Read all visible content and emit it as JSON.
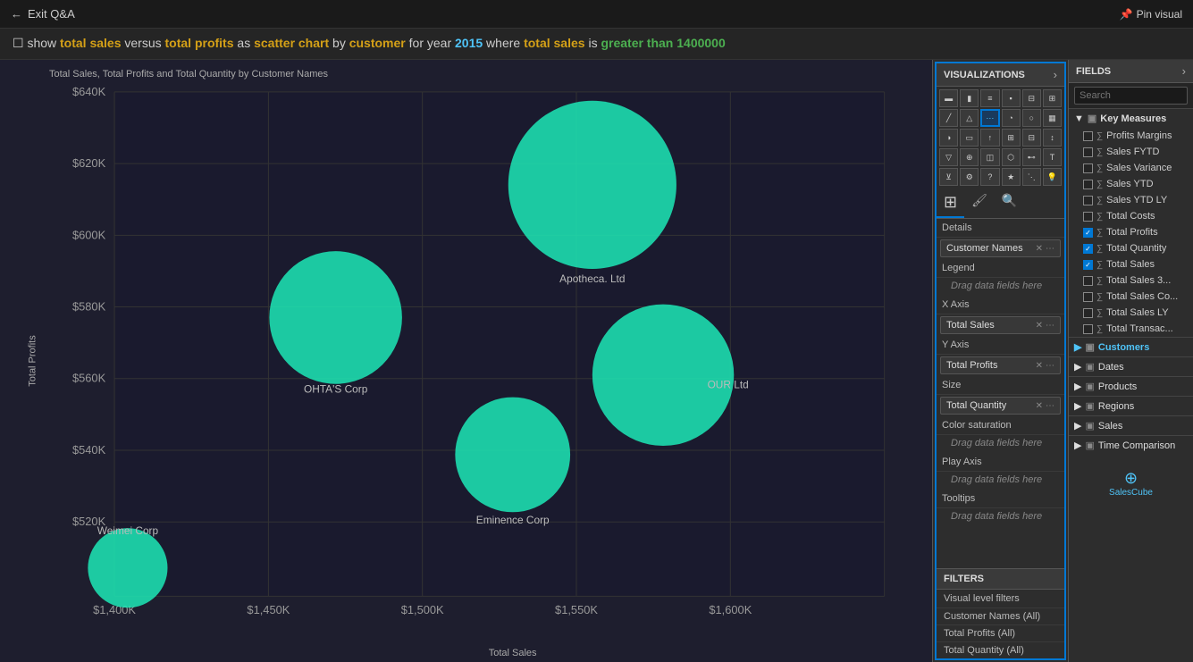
{
  "topbar": {
    "back_label": "Exit Q&A",
    "pin_label": "Pin visual"
  },
  "querybar": {
    "prefix": "show ",
    "total_sales": "total sales",
    "vs": " versus ",
    "total_profits": "total profits",
    "as": " as ",
    "scatter_chart": "scatter chart",
    "by": " by ",
    "customer": "customer",
    "for_year": " for year ",
    "year": "2015",
    "where": " where ",
    "total_sales2": "total sales",
    "is": " is ",
    "condition": "greater than 1400000"
  },
  "chart": {
    "title": "Total Sales, Total Profits and Total Quantity by Customer Names",
    "y_axis_label": "Total Profits",
    "x_axis_label": "Total Sales",
    "y_ticks": [
      "$640K",
      "$620K",
      "$600K",
      "$580K",
      "$560K",
      "$540K",
      "$520K"
    ],
    "x_ticks": [
      "$1,400K",
      "$1,450K",
      "$1,500K",
      "$1,550K",
      "$1,600K"
    ],
    "bubbles": [
      {
        "label": "Apotheca. Ltd",
        "cx": 63,
        "cy": 18,
        "r": 55
      },
      {
        "label": "OHTA'S Corp",
        "cx": 34,
        "cy": 37,
        "r": 45
      },
      {
        "label": "OUR Ltd",
        "cx": 73,
        "cy": 55,
        "r": 48
      },
      {
        "label": "Eminence Corp",
        "cx": 56,
        "cy": 67,
        "r": 40
      },
      {
        "label": "Weimei Corp",
        "cx": 8,
        "cy": 82,
        "r": 25
      }
    ]
  },
  "visualizations": {
    "header": "VISUALIZATIONS",
    "expand_icon": "›",
    "icon_rows": [
      [
        "bar",
        "col",
        "stacked-bar",
        "stacked-col",
        "100-bar",
        "100-col"
      ],
      [
        "line",
        "area",
        "scatter",
        "pie",
        "donut",
        "treemap"
      ],
      [
        "gauge",
        "card",
        "kpi",
        "table",
        "matrix",
        "waterfall"
      ],
      [
        "funnel",
        "map",
        "filled-map",
        "shape-map",
        "slicer",
        "text"
      ],
      [
        "filter",
        "drill",
        "qna",
        "key-influencer",
        "decomp",
        "smart"
      ]
    ],
    "fields_sections": [
      {
        "label": "Details",
        "field": "Customer Names",
        "has_field": true
      },
      {
        "label": "Legend",
        "field": null,
        "drag_text": "Drag data fields here"
      },
      {
        "label": "X Axis",
        "field": "Total Sales",
        "has_field": true
      },
      {
        "label": "Y Axis",
        "field": "Total Profits",
        "has_field": true
      },
      {
        "label": "Size",
        "field": "Total Quantity",
        "has_field": true
      },
      {
        "label": "Color saturation",
        "field": null,
        "drag_text": "Drag data fields here"
      },
      {
        "label": "Play Axis",
        "field": null,
        "drag_text": "Drag data fields here"
      },
      {
        "label": "Tooltips",
        "field": null,
        "drag_text": "Drag data fields here"
      }
    ]
  },
  "fields": {
    "header": "FIELDS",
    "expand_icon": "›",
    "search_placeholder": "Search",
    "groups": [
      {
        "name": "Key Measures",
        "icon": "▣",
        "expanded": true,
        "items": [
          {
            "label": "Profits Margins",
            "checked": false
          },
          {
            "label": "Sales FYTD",
            "checked": false
          },
          {
            "label": "Sales Variance",
            "checked": false
          },
          {
            "label": "Sales YTD",
            "checked": false
          },
          {
            "label": "Sales YTD LY",
            "checked": false
          },
          {
            "label": "Total Costs",
            "checked": false
          },
          {
            "label": "Total Profits",
            "checked": true
          },
          {
            "label": "Total Quantity",
            "checked": true
          },
          {
            "label": "Total Sales",
            "checked": true
          },
          {
            "label": "Total Sales 3...",
            "checked": false
          },
          {
            "label": "Total Sales Co...",
            "checked": false
          },
          {
            "label": "Total Sales LY",
            "checked": false
          },
          {
            "label": "Total Transac...",
            "checked": false
          }
        ]
      },
      {
        "name": "Customers",
        "icon": "▣",
        "expanded": false,
        "active": true,
        "items": []
      },
      {
        "name": "Dates",
        "icon": "▣",
        "expanded": false,
        "items": []
      },
      {
        "name": "Products",
        "icon": "▣",
        "expanded": false,
        "items": []
      },
      {
        "name": "Regions",
        "icon": "▣",
        "expanded": false,
        "items": []
      },
      {
        "name": "Sales",
        "icon": "▣",
        "expanded": false,
        "items": []
      },
      {
        "name": "Time Comparison",
        "icon": "▣",
        "expanded": false,
        "items": []
      }
    ]
  },
  "filters": {
    "header": "FILTERS",
    "visual_level": "Visual level filters",
    "items": [
      "Customer Names (All)",
      "Total Profits (All)",
      "Total Quantity (All)"
    ]
  },
  "sidebar_bottom": {
    "logo_text": "SalesCube"
  }
}
